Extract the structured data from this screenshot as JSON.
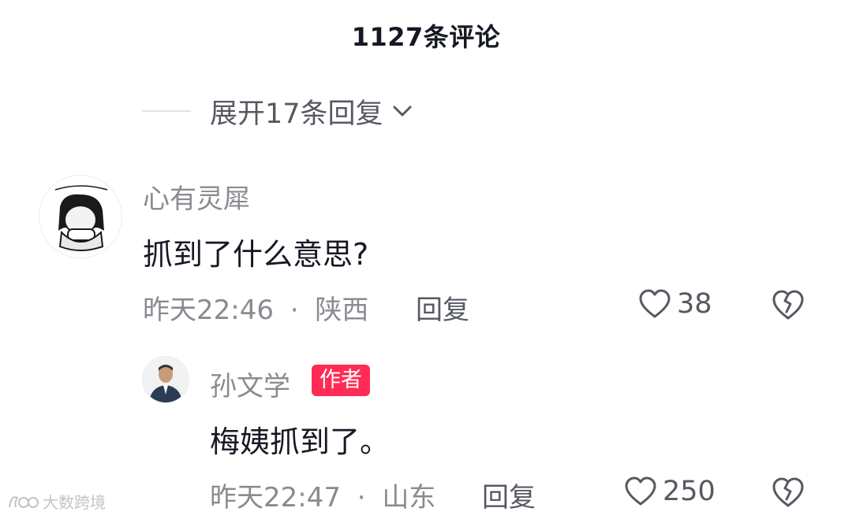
{
  "header": {
    "title": "1127条评论"
  },
  "expand": {
    "label": "展开17条回复"
  },
  "comments": [
    {
      "username": "心有灵犀",
      "text": "抓到了什么意思?",
      "time": "昨天22:46",
      "separator": "·",
      "location": "陕西",
      "reply_label": "回复",
      "likes": "38"
    },
    {
      "username": "孙文学",
      "badge": "作者",
      "text": "梅姨抓到了。",
      "time": "昨天22:47",
      "separator": "·",
      "location": "山东",
      "reply_label": "回复",
      "likes": "250"
    }
  ],
  "watermark": {
    "text": "大数跨境"
  },
  "colors": {
    "badge": "#fe2c55",
    "muted": "#8a8b91",
    "text": "#161823"
  }
}
